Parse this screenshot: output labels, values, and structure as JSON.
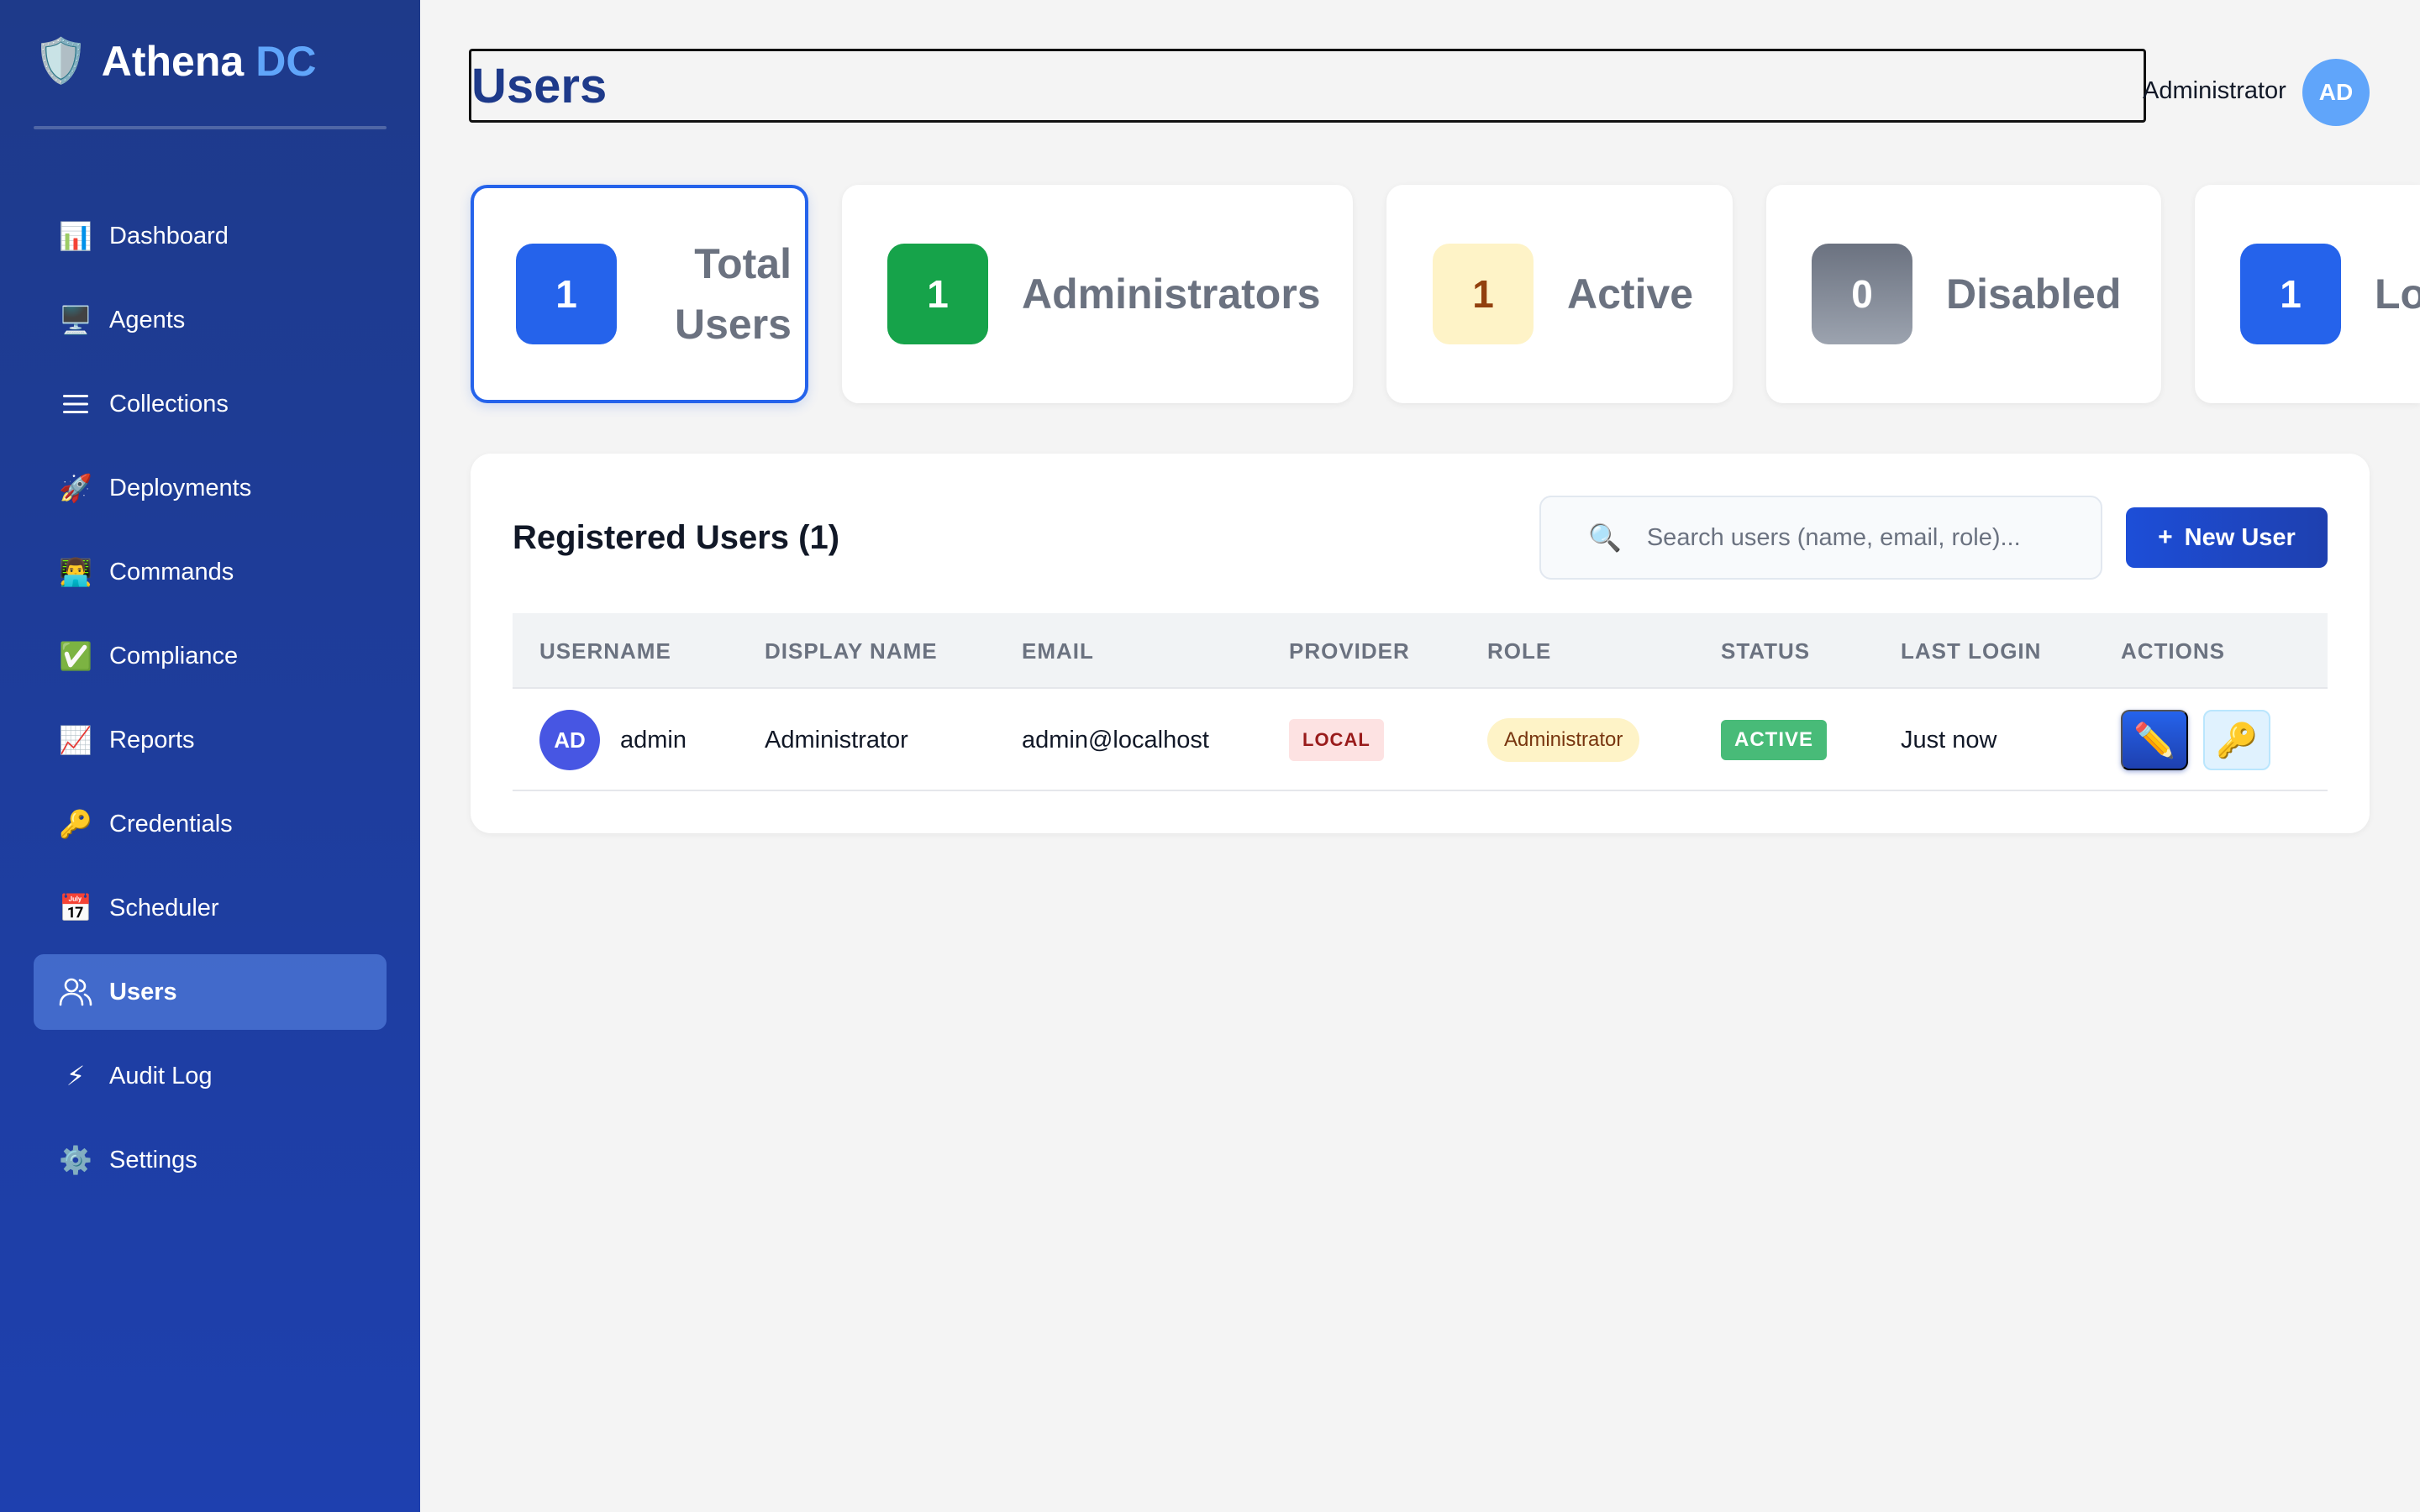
{
  "brand": {
    "icon": "shield-icon",
    "name": "Athena",
    "accent": "DC"
  },
  "sidebar": {
    "items": [
      {
        "label": "Dashboard",
        "icon": "bar-chart-icon",
        "glyph": "📊",
        "active": false
      },
      {
        "label": "Agents",
        "icon": "monitor-icon",
        "glyph": "🖥️",
        "active": false
      },
      {
        "label": "Collections",
        "icon": "list-icon",
        "glyph": "☰",
        "active": false
      },
      {
        "label": "Deployments",
        "icon": "rocket-icon",
        "glyph": "🚀",
        "active": false
      },
      {
        "label": "Commands",
        "icon": "technologist-icon",
        "glyph": "👨‍💻",
        "active": false
      },
      {
        "label": "Compliance",
        "icon": "check-icon",
        "glyph": "✅",
        "active": false
      },
      {
        "label": "Reports",
        "icon": "trend-chart-icon",
        "glyph": "📈",
        "active": false
      },
      {
        "label": "Credentials",
        "icon": "key-icon",
        "glyph": "🔑",
        "active": false
      },
      {
        "label": "Scheduler",
        "icon": "calendar-icon",
        "glyph": "📅",
        "active": false
      },
      {
        "label": "Users",
        "icon": "users-icon",
        "glyph": "",
        "active": true
      },
      {
        "label": "Audit Log",
        "icon": "lightning-icon",
        "glyph": "⚡",
        "active": false
      },
      {
        "label": "Settings",
        "icon": "gear-icon",
        "glyph": "⚙️",
        "active": false
      }
    ]
  },
  "header": {
    "title": "Users",
    "user_name": "Administrator",
    "user_initials": "AD"
  },
  "stats": [
    {
      "value": "1",
      "label_line1": "Total",
      "label_line2": "Users",
      "color": "#2563eb",
      "text_color": "#ffffff"
    },
    {
      "value": "1",
      "label": "Administrators",
      "color": "#16a34a",
      "text_color": "#ffffff"
    },
    {
      "value": "1",
      "label": "Active",
      "color": "#fef3c7",
      "text_color": "#92400e"
    },
    {
      "value": "0",
      "label": "Disabled",
      "color": "#6b7280",
      "text_color": "#ffffff"
    },
    {
      "value": "1",
      "label": "Lo",
      "color": "#2563eb",
      "text_color": "#ffffff"
    }
  ],
  "users_panel": {
    "title": "Registered Users (1)",
    "search_placeholder": "Search users (name, email, role)...",
    "new_user_label": "New User",
    "new_user_plus": "+",
    "columns": [
      "USERNAME",
      "DISPLAY NAME",
      "EMAIL",
      "PROVIDER",
      "ROLE",
      "STATUS",
      "LAST LOGIN",
      "ACTIONS"
    ],
    "rows": [
      {
        "initials": "AD",
        "username": "admin",
        "display_name": "Administrator",
        "email": "admin@localhost",
        "provider": "LOCAL",
        "role": "Administrator",
        "status": "ACTIVE",
        "last_login": "Just now",
        "actions": [
          {
            "icon": "pencil-icon",
            "glyph": "✏️"
          },
          {
            "icon": "key-icon",
            "glyph": "🔑"
          }
        ]
      }
    ]
  },
  "colors": {
    "sidebar_top": "#1e3a8a",
    "sidebar_bottom": "#1e40af",
    "accent": "#2563eb",
    "brand_accent": "#60a5fa"
  }
}
